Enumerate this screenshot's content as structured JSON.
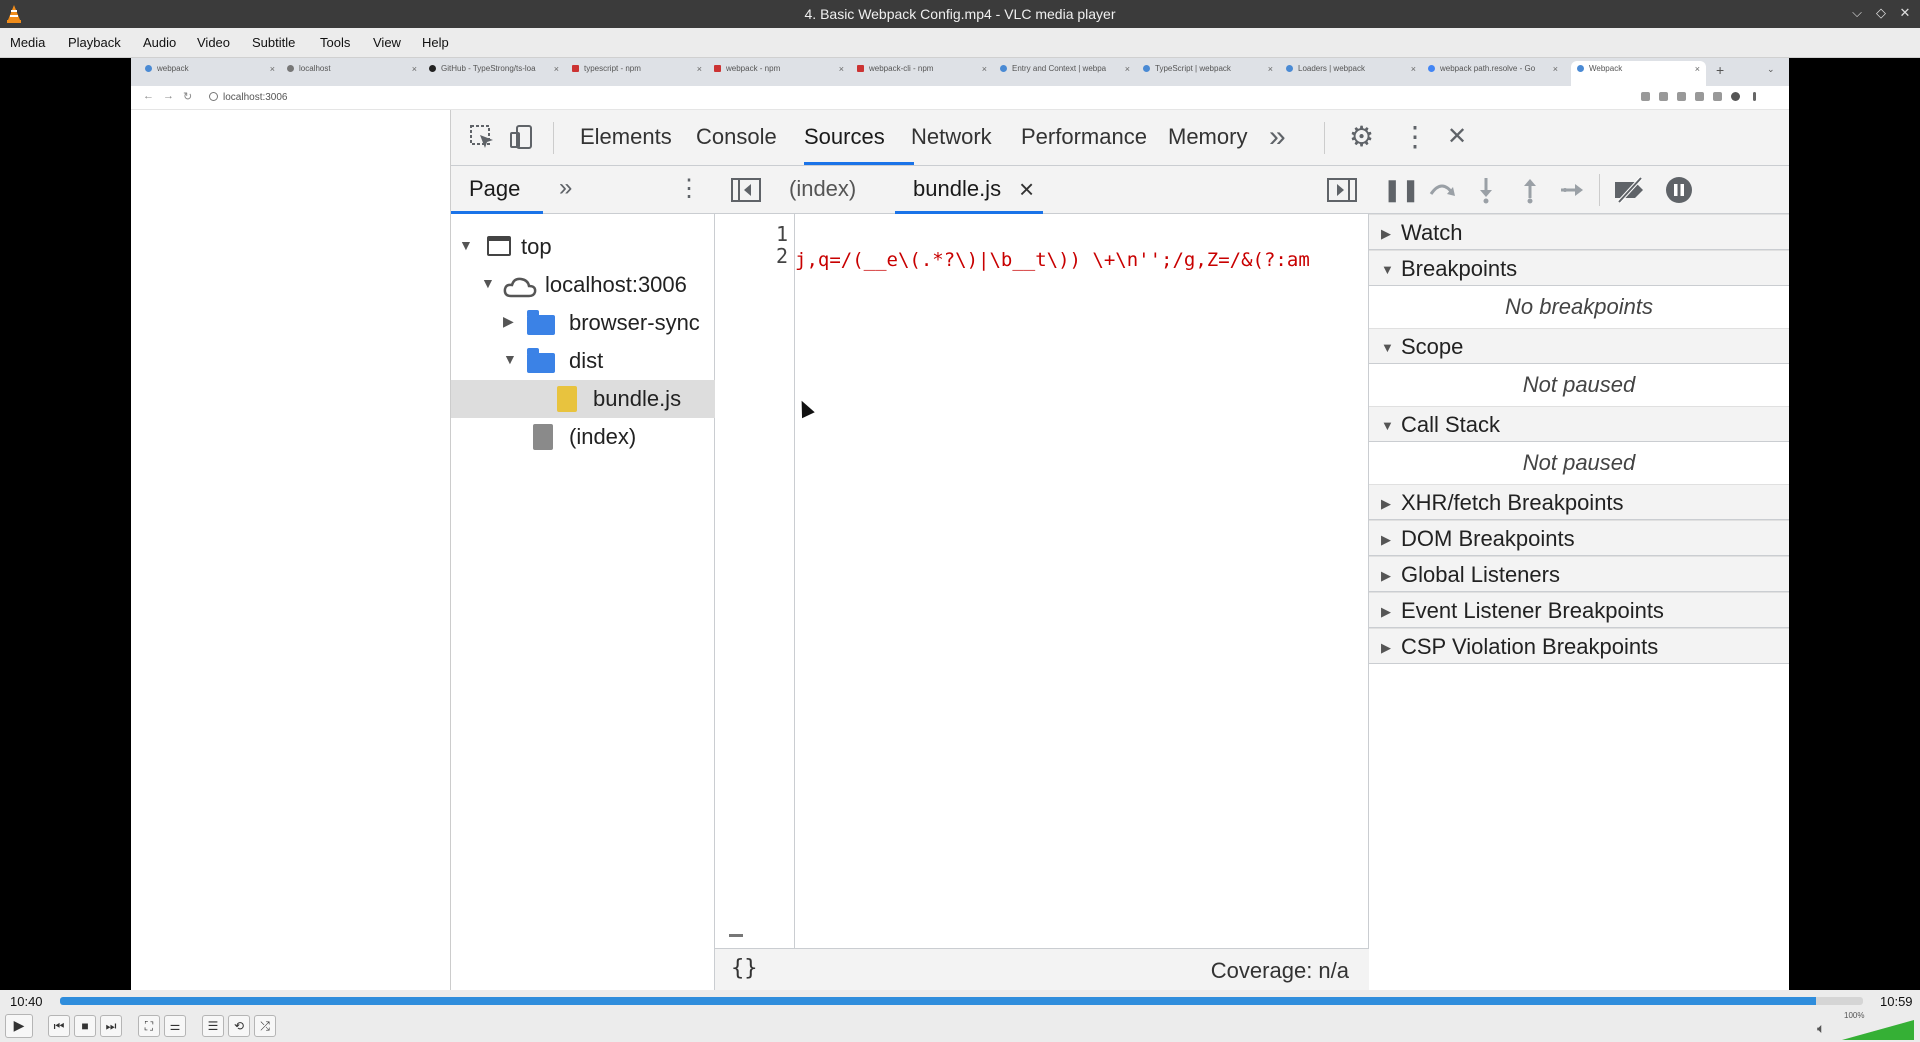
{
  "window": {
    "title": "4. Basic Webpack Config.mp4 - VLC media player",
    "minimize_label": "⌵",
    "maximize_label": "◇",
    "close_label": "✕"
  },
  "menu": [
    "Media",
    "Playback",
    "Audio",
    "Video",
    "Subtitle",
    "Tools",
    "View",
    "Help"
  ],
  "browser": {
    "tabs": [
      {
        "label": "webpack"
      },
      {
        "label": "localhost"
      },
      {
        "label": "GitHub - TypeStrong/ts-loa"
      },
      {
        "label": "typescript - npm"
      },
      {
        "label": "webpack - npm"
      },
      {
        "label": "webpack-cli - npm"
      },
      {
        "label": "Entry and Context | webpa"
      },
      {
        "label": "TypeScript | webpack"
      },
      {
        "label": "Loaders | webpack"
      },
      {
        "label": "webpack path.resolve - Go"
      },
      {
        "label": "Webpack"
      }
    ],
    "close_tab_label": "×",
    "new_tab_label": "+",
    "tab_list_label": "⌄",
    "back_label": "←",
    "forward_label": "→",
    "reload_label": "↻",
    "url": "localhost:3006"
  },
  "devtools": {
    "tabs": [
      "Elements",
      "Console",
      "Sources",
      "Network",
      "Performance",
      "Memory"
    ],
    "active_tab": "Sources",
    "more_tabs_label": "»",
    "settings_label": "⚙",
    "kebab_label": "⋮",
    "close_label": "✕",
    "navigator": {
      "tab_label": "Page",
      "more_label": "»",
      "tree": [
        {
          "label": "top"
        },
        {
          "label": "localhost:3006"
        },
        {
          "label": "browser-sync"
        },
        {
          "label": "dist"
        },
        {
          "label": "bundle.js"
        },
        {
          "label": "(index)"
        }
      ]
    },
    "editor": {
      "tabs": [
        {
          "label": "(index)"
        },
        {
          "label": "bundle.js",
          "close": "×"
        }
      ],
      "line_numbers": [
        "1",
        "2"
      ],
      "code_line_2": "j,q=/(__e\\(.*?\\)|\\b__t\\)) \\+\\n'';/g,Z=/&(?:am",
      "pretty_print_label": "{}",
      "coverage": "Coverage: n/a"
    },
    "debugger": {
      "sections": [
        {
          "title": "Watch",
          "expanded": false
        },
        {
          "title": "Breakpoints",
          "expanded": true,
          "body": "No breakpoints"
        },
        {
          "title": "Scope",
          "expanded": true,
          "body": "Not paused"
        },
        {
          "title": "Call Stack",
          "expanded": true,
          "body": "Not paused"
        },
        {
          "title": "XHR/fetch Breakpoints",
          "expanded": false
        },
        {
          "title": "DOM Breakpoints",
          "expanded": false
        },
        {
          "title": "Global Listeners",
          "expanded": false
        },
        {
          "title": "Event Listener Breakpoints",
          "expanded": false
        },
        {
          "title": "CSP Violation Breakpoints",
          "expanded": false
        }
      ]
    }
  },
  "player": {
    "elapsed": "10:40",
    "total": "10:59",
    "progress": 0.974,
    "volume_label": "100%",
    "volume": 1.0,
    "controls": {
      "play": "▶",
      "prev": "⏮",
      "stop": "■",
      "next": "⏭",
      "fullscreen": "⛶",
      "extended": "⚌",
      "playlist": "☰",
      "loop": "⟲",
      "shuffle": "⤮"
    }
  },
  "colors": {
    "accent": "#1a73e8",
    "seek_fill": "#2f8ddc",
    "code_string": "#c80000"
  }
}
